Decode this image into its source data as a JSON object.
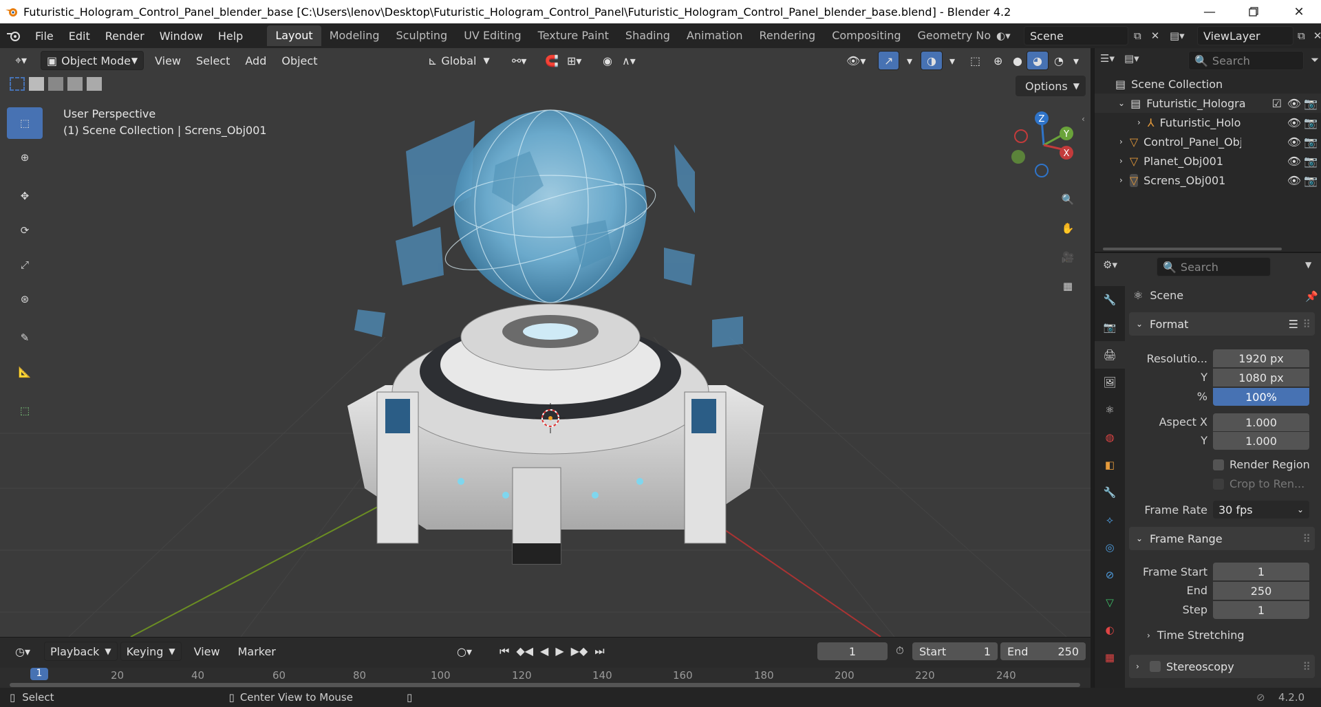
{
  "window": {
    "title": "Futuristic_Hologram_Control_Panel_blender_base [C:\\Users\\lenov\\Desktop\\Futuristic_Hologram_Control_Panel\\Futuristic_Hologram_Control_Panel_blender_base.blend] - Blender 4.2"
  },
  "menu": [
    "File",
    "Edit",
    "Render",
    "Window",
    "Help"
  ],
  "workspaces": [
    "Layout",
    "Modeling",
    "Sculpting",
    "UV Editing",
    "Texture Paint",
    "Shading",
    "Animation",
    "Rendering",
    "Compositing",
    "Geometry Nod"
  ],
  "active_workspace": "Layout",
  "scene_name": "Scene",
  "view_layer": "ViewLayer",
  "viewport": {
    "mode": "Object Mode",
    "menus": [
      "View",
      "Select",
      "Add",
      "Object"
    ],
    "transform_orientation": "Global",
    "options_label": "Options",
    "perspective": "User Perspective",
    "context": "(1) Scene Collection | Screns_Obj001",
    "gizmo_axes": [
      "Z",
      "Y",
      "X"
    ]
  },
  "timeline": {
    "menus": [
      "Playback",
      "Keying",
      "View",
      "Marker"
    ],
    "current_frame": "1",
    "start_label": "Start",
    "start_value": "1",
    "end_label": "End",
    "end_value": "250",
    "ruler_ticks": [
      "1",
      "20",
      "40",
      "60",
      "80",
      "100",
      "120",
      "140",
      "160",
      "180",
      "200",
      "220",
      "240"
    ]
  },
  "outliner": {
    "search_placeholder": "Search",
    "root": "Scene Collection",
    "items": [
      "Futuristic_Hologra",
      "Futuristic_Holo",
      "Control_Panel_Obj(",
      "Planet_Obj001",
      "Screns_Obj001"
    ]
  },
  "properties": {
    "search_placeholder": "Search",
    "context": "Scene",
    "format_panel": "Format",
    "resolution_x_label": "Resolutio...",
    "resolution_x": "1920 px",
    "resolution_y_label": "Y",
    "resolution_y": "1080 px",
    "percent_label": "%",
    "percent": "100%",
    "aspect_x_label": "Aspect X",
    "aspect_x": "1.000",
    "aspect_y_label": "Y",
    "aspect_y": "1.000",
    "render_region": "Render Region",
    "crop": "Crop to Ren...",
    "frame_rate_label": "Frame Rate",
    "frame_rate": "30 fps",
    "frame_range_panel": "Frame Range",
    "frame_start_label": "Frame Start",
    "frame_start": "1",
    "end_label": "End",
    "end": "250",
    "step_label": "Step",
    "step": "1",
    "time_stretching": "Time Stretching",
    "stereoscopy": "Stereoscopy"
  },
  "statusbar": {
    "select": "Select",
    "center_view": "Center View to Mouse",
    "version": "4.2.0"
  }
}
